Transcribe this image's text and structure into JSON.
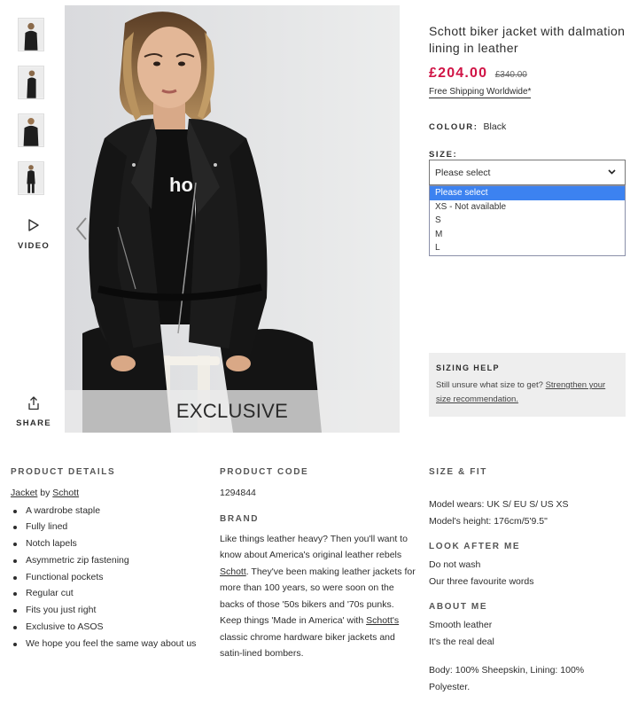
{
  "gallery": {
    "thumbnails": [
      "thumb-front",
      "thumb-side",
      "thumb-back",
      "thumb-full"
    ],
    "video_label": "VIDEO",
    "share_label": "SHARE",
    "overlay_text": "EXCLUSIVE",
    "photo_letters": "ho"
  },
  "product": {
    "title": "Schott biker jacket with dalmation lining in leather",
    "price_now": "£204.00",
    "price_was": "£340.00",
    "shipping": "Free Shipping Worldwide*",
    "colour_label": "COLOUR:",
    "colour_value": "Black",
    "size_label": "SIZE:",
    "size_select_value": "Please select",
    "size_options": [
      "Please select",
      "XS - Not available",
      "S",
      "M",
      "L"
    ]
  },
  "sizing_help": {
    "heading": "SIZING HELP",
    "text": "Still unsure what size to get?",
    "link": "Strengthen your size recommendation."
  },
  "details": {
    "product_details": {
      "heading": "PRODUCT DETAILS",
      "type_link": "Jacket",
      "by": "by",
      "brand_link": "Schott",
      "bullets": [
        "A wardrobe staple",
        "Fully lined",
        "Notch lapels",
        "Asymmetric zip fastening",
        "Functional pockets",
        "Regular cut",
        "Fits you just right",
        "Exclusive to ASOS",
        "We hope you feel the same way about us"
      ]
    },
    "product_code": {
      "heading": "PRODUCT CODE",
      "value": "1294844"
    },
    "brand": {
      "heading": "BRAND",
      "text_1": "Like things leather heavy? Then you'll want to know about America's original leather rebels",
      "link_1": "Schott",
      "text_2": ". They've been making leather jackets for more than 100 years, so were soon on the backs of those '50s bikers and '70s punks. Keep things 'Made in America' with",
      "link_2": "Schott's",
      "text_3": "classic chrome hardware biker jackets and satin-lined bombers."
    },
    "size_fit": {
      "heading": "SIZE & FIT",
      "model_wears": "Model wears: UK S/ EU S/ US XS",
      "model_height": "Model's height: 176cm/5'9.5\""
    },
    "look_after": {
      "heading": "LOOK AFTER ME",
      "line_1": "Do not wash",
      "line_2": "Our three favourite words"
    },
    "about": {
      "heading": "ABOUT ME",
      "line_1": "Smooth leather",
      "line_2": "It's the real deal",
      "composition": "Body: 100% Sheepskin, Lining: 100% Polyester."
    }
  },
  "icons": [
    "play-icon",
    "share-icon",
    "chevron-left-icon",
    "chevron-right-icon",
    "chevron-down-icon"
  ],
  "colors": {
    "price": "#d01345",
    "highlight": "#3c82f0",
    "panel": "#eeeeee"
  }
}
